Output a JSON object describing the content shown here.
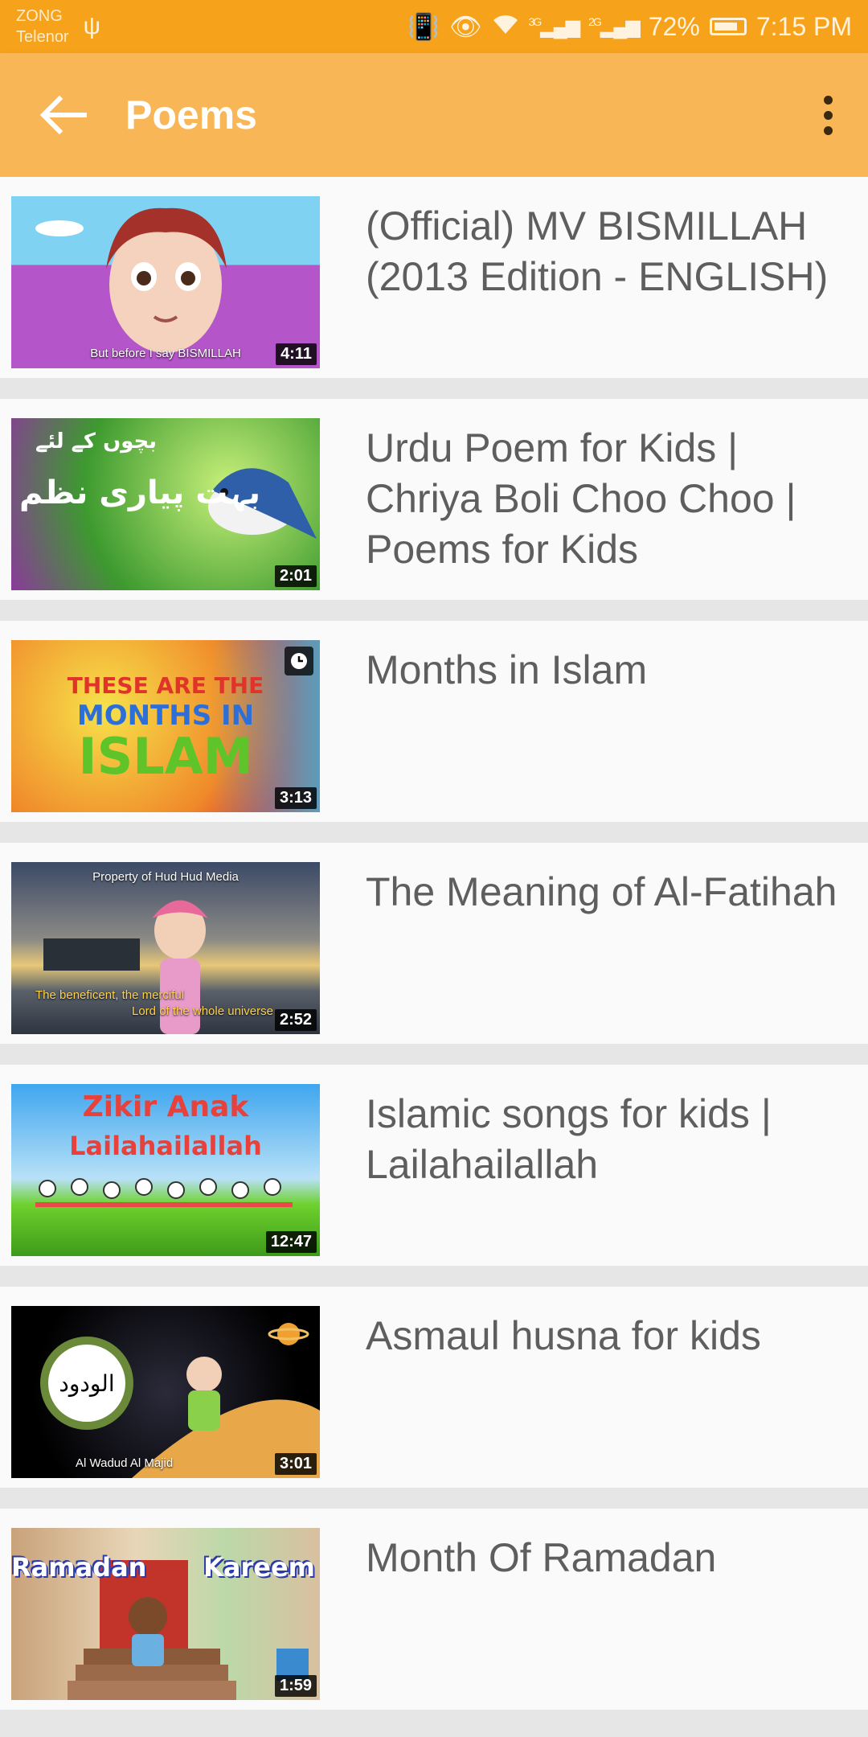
{
  "status_bar": {
    "carrier_line1": "ZONG",
    "carrier_line2": "Telenor",
    "net1": "3G",
    "net2": "2G",
    "battery_percent": "72%",
    "time": "7:15 PM"
  },
  "app_bar": {
    "title": "Poems",
    "back_icon": "arrow-left-icon",
    "menu_icon": "more-vert-icon"
  },
  "videos": [
    {
      "title": "(Official) MV BISMILLAH (2013 Edition - ENGLISH)",
      "duration": "4:11",
      "caption": "But before I say BISMILLAH"
    },
    {
      "title": "Urdu Poem for Kids | Chriya Boli Choo Choo | Poems for Kids",
      "duration": "2:01",
      "caption_top": "بچوں کے لئے",
      "caption_main": "بہت پیاری نظم"
    },
    {
      "title": "Months in Islam",
      "duration": "3:13",
      "line1": "THESE ARE THE",
      "line2": "MONTHS IN",
      "line3": "ISLAM"
    },
    {
      "title": "The Meaning of Al-Fatihah",
      "duration": "2:52",
      "top_caption": "Property of Hud Hud Media",
      "line1": "The beneficent, the merciful",
      "line2": "Lord of the whole universe"
    },
    {
      "title": "Islamic songs for kids | Lailahailallah",
      "duration": "12:47",
      "line1": "Zikir Anak",
      "line2": "Lailahailallah"
    },
    {
      "title": "Asmaul husna for kids",
      "duration": "3:01",
      "emblem": "الودود",
      "caption": "Al Wadud Al Majid"
    },
    {
      "title": "Month Of Ramadan",
      "duration": "1:59",
      "word1": "Ramadan",
      "word2": "Kareem"
    }
  ],
  "colors": {
    "status_bar": "#f7a21b",
    "app_bar": "#f9b657",
    "card_bg": "#fafafa",
    "divider": "#e6e6e6",
    "title_text": "#5e5e5e"
  }
}
